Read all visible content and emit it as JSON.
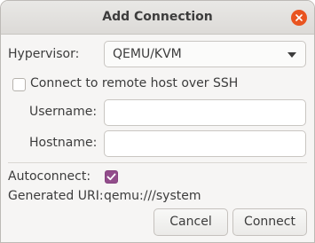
{
  "window": {
    "title": "Add Connection"
  },
  "hypervisor": {
    "label": "Hypervisor:",
    "selected": "QEMU/KVM"
  },
  "remote": {
    "label": "Connect to remote host over SSH",
    "checked": false
  },
  "username": {
    "label": "Username:",
    "value": ""
  },
  "hostname": {
    "label": "Hostname:",
    "value": ""
  },
  "autoconnect": {
    "label": "Autoconnect:",
    "checked": true
  },
  "uri": {
    "label": "Generated URI:",
    "value": "qemu:///system"
  },
  "buttons": {
    "cancel": "Cancel",
    "connect": "Connect"
  },
  "colors": {
    "accent": "#924d8b",
    "close": "#e95420"
  }
}
